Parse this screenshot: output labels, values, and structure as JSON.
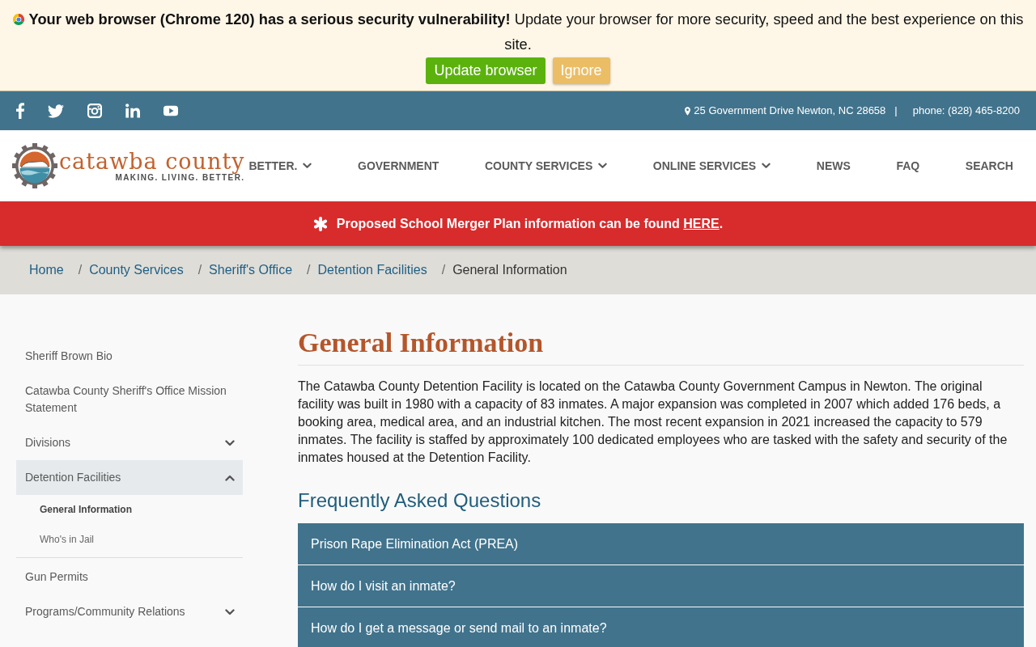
{
  "update_banner": {
    "message": "**Your web browser (Chrome 120) has a serious security vulnerability!** Update your browser for more security, speed and the best experience on this site.",
    "buttons": [
      {
        "label": "Update browser",
        "kind": "primary"
      },
      {
        "label": "Ignore",
        "kind": "secondary"
      }
    ]
  },
  "top_bar": {
    "address": "25 Government Drive Newton, NC 28658",
    "separator": "|",
    "phone": "phone: (828) 465-8200"
  },
  "logo": {
    "name": "catawba county",
    "tagline": "MAKING. LIVING. BETTER."
  },
  "nav": {
    "items": [
      {
        "label": "BETTER.",
        "has_menu": true
      },
      {
        "label": "GOVERNMENT",
        "has_menu": false
      },
      {
        "label": "COUNTY SERVICES",
        "has_menu": true
      },
      {
        "label": "ONLINE SERVICES",
        "has_menu": true
      },
      {
        "label": "NEWS",
        "has_menu": false
      },
      {
        "label": "FAQ",
        "has_menu": false
      },
      {
        "label": "SEARCH",
        "has_menu": false
      }
    ]
  },
  "alert": {
    "text": "Proposed School Merger Plan information can be found",
    "link": "HERE",
    "end": "."
  },
  "breadcrumb": [
    {
      "label": "Home",
      "current": false
    },
    {
      "separator": "/",
      "label": "County Services",
      "current": false
    },
    {
      "separator": "/",
      "label": "Sheriff's Office",
      "current": false
    },
    {
      "separator": "/",
      "label": "Detention Facilities",
      "current": false
    },
    {
      "separator": "/",
      "label": "General Information",
      "current": true
    }
  ],
  "sidebar": {
    "items": [
      {
        "label": "Sheriff Brown Bio",
        "kind": "link",
        "expanded": false
      },
      {
        "label": "Catawba County Sheriff's Office Mission Statement",
        "kind": "link",
        "expanded": false
      },
      {
        "label": "Divisions",
        "kind": "menu",
        "expanded": false
      },
      {
        "label": "Detention Facilities",
        "kind": "menu",
        "expanded": true,
        "children": [
          {
            "label": "General Information",
            "selected": true
          },
          {
            "label": "Who's in Jail",
            "selected": false
          }
        ]
      },
      {
        "label": "Gun Permits",
        "kind": "link",
        "expanded": false
      },
      {
        "label": "Programs/Community Relations",
        "kind": "menu",
        "expanded": false
      }
    ]
  },
  "content": {
    "title": "General Information",
    "body": "The Catawba County Detention Facility is located on the Catawba County Government Campus in Newton. The original facility was built in 1980 with a capacity of 83 inmates. A major expansion was completed in 2007 which added 176 beds, a booking area, medical area, and an industrial kitchen. The most recent expansion in 2021 increased the capacity to 579 inmates. The facility is staffed by approximately 100 dedicated employees who are tasked with the safety and security of the inmates housed at the Detention Facility.",
    "faq_title": "Frequently Asked Questions",
    "faq": [
      {
        "question": "Prison Rape Elimination Act (PREA)"
      },
      {
        "question": "How do I visit an inmate?"
      },
      {
        "question": "How do I get a message or send mail to an inmate?"
      }
    ]
  }
}
